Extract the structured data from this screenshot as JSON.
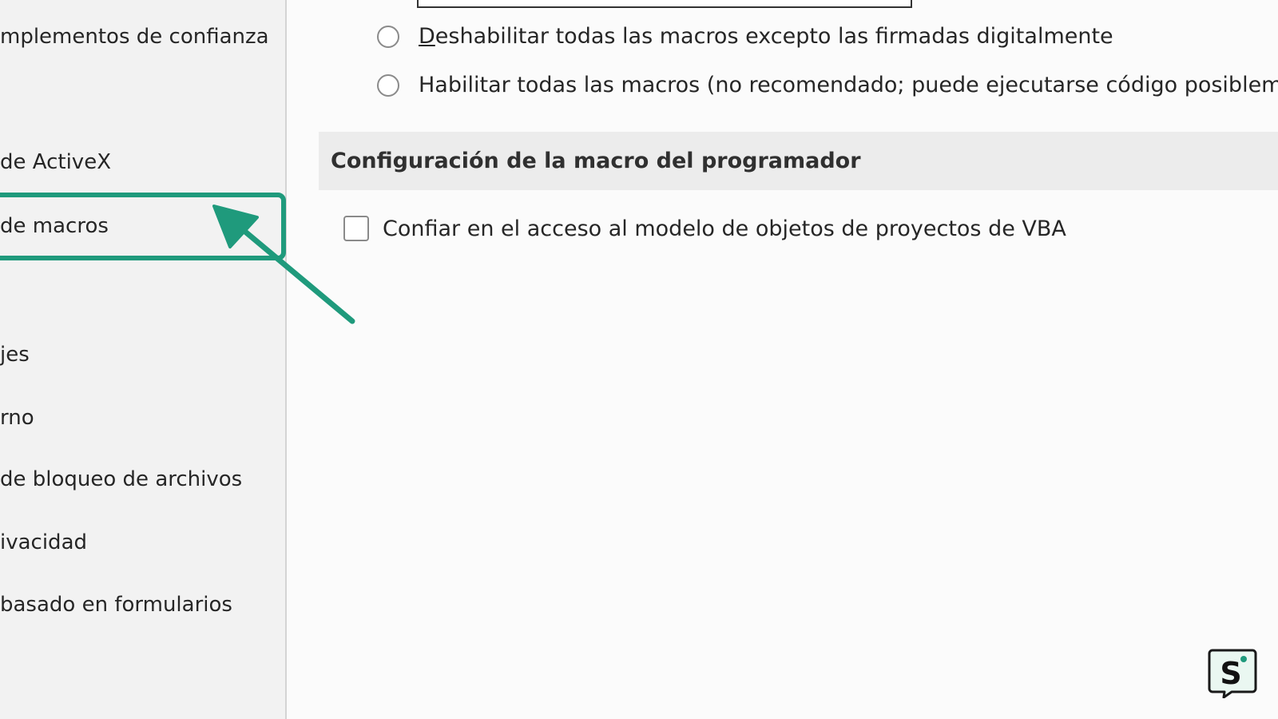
{
  "sidebar": {
    "items": [
      {
        "label": "mplementos de confianza"
      },
      {
        "label": "de ActiveX"
      },
      {
        "label": "de macros"
      },
      {
        "label": "jes"
      },
      {
        "label": "rno"
      },
      {
        "label": "de bloqueo de archivos"
      },
      {
        "label": "ivacidad"
      },
      {
        "label": " basado en formularios"
      }
    ],
    "selected_index": 2
  },
  "macro_settings": {
    "options": [
      {
        "label_first": "D",
        "label_rest": "eshabilitar todas las macros excepto las firmadas digitalmente",
        "selected": false
      },
      {
        "label": "Habilitar todas las macros (no recomendado; puede ejecutarse código posiblemen",
        "selected": false
      }
    ]
  },
  "developer_section": {
    "title": "Configuración de la macro del programador",
    "trust_vba_label": "Confiar en el acceso al modelo de objetos de proyectos de VBA",
    "trust_vba_checked": false
  },
  "colors": {
    "accent": "#1f9a7c",
    "sidebar_bg": "#f2f2f2",
    "section_header_bg": "#ececec"
  },
  "logo": {
    "icon": "brand-s-logo"
  }
}
